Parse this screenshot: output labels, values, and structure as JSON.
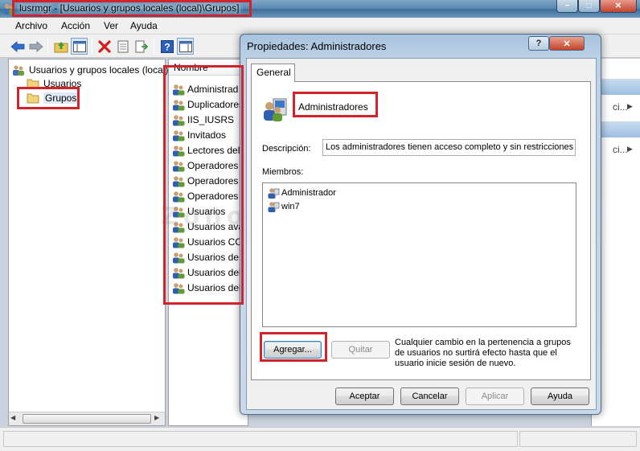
{
  "window": {
    "title": "lusrmgr - [Usuarios y grupos locales (local)\\Grupos]",
    "controls": {
      "minimize": "−",
      "maximize": "□",
      "close": "✕"
    }
  },
  "menu": {
    "items": [
      "Archivo",
      "Acción",
      "Ver",
      "Ayuda"
    ]
  },
  "toolbar": {
    "buttons": [
      "back-arrow-icon",
      "forward-arrow-icon",
      "up-folder-icon",
      "show-hide-tree-icon",
      "delete-icon",
      "properties-icon",
      "export-list-icon",
      "help-icon",
      "show-hide-action-pane-icon"
    ]
  },
  "tree": {
    "root": "Usuarios y grupos locales (local)",
    "children": [
      "Usuarios",
      "Grupos"
    ],
    "selected": "Grupos"
  },
  "list": {
    "column": "Nombre",
    "rows": [
      "Administrad",
      "Duplicadores",
      "IIS_IUSRS",
      "Invitados",
      "Lectores del",
      "Operadores d",
      "Operadores c",
      "Operadores d",
      "Usuarios",
      "Usuarios ava",
      "Usuarios CO",
      "Usuarios de d",
      "Usuarios del",
      "Usuarios del"
    ]
  },
  "actions_pane": {
    "row1": "ci...",
    "row2": "ci..."
  },
  "watermark": "Zono System",
  "dialog": {
    "title": "Propiedades: Administradores",
    "help": "?",
    "close": "✕",
    "tab": "General",
    "group_name": "Administradores",
    "description_label": "Descripción:",
    "description_value": "Los administradores tienen acceso completo y sin restricciones al",
    "members_label": "Miembros:",
    "members": [
      "Administrador",
      "win7"
    ],
    "add_button": "Agregar...",
    "remove_button": "Quitar",
    "note": "Cualquier cambio en la pertenencia a grupos de usuarios no surtirá efecto hasta que el usuario inicie sesión de nuevo.",
    "ok_button": "Aceptar",
    "cancel_button": "Cancelar",
    "apply_button": "Aplicar",
    "help_button": "Ayuda"
  },
  "colors": {
    "highlight_box": "#d2232a",
    "accent": "#3f6f99"
  }
}
